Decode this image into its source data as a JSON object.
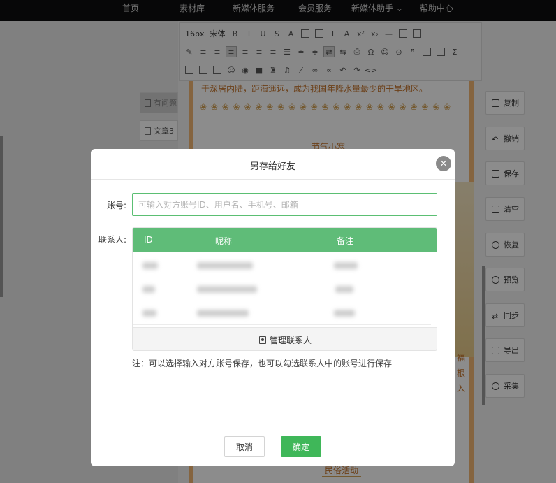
{
  "nav": {
    "items": [
      "首页",
      "素材库",
      "新媒体服务",
      "会员服务",
      "新媒体助手",
      "帮助中心"
    ],
    "dropdown_mark": "⌄"
  },
  "doc_tabs": [
    "有问题",
    "文章3"
  ],
  "toolbar": {
    "font_size": "16px",
    "font_family": "宋体"
  },
  "editor": {
    "paragraph": "于深居内陆，距海遥远，成为我国年降水量最少的干旱地区。",
    "leaves": "❀ ❀ ❀ ❀ ❀ ❀ ❀ ❀ ❀ ❀ ❀ ❀ ❀ ❀ ❀ ❀ ❀ ❀ ❀ ❀ ❀ ❀ ❀",
    "section_title": "节气小寒",
    "side_chars": [
      "福",
      "根",
      "入"
    ],
    "folk": "民俗活动"
  },
  "actions": [
    {
      "label": "复制",
      "icon": "copy-icon"
    },
    {
      "label": "撤销",
      "icon": "undo-icon"
    },
    {
      "label": "保存",
      "icon": "save-icon"
    },
    {
      "label": "清空",
      "icon": "trash-icon"
    },
    {
      "label": "恢复",
      "icon": "restore-icon"
    },
    {
      "label": "预览",
      "icon": "eye-icon"
    },
    {
      "label": "同步",
      "icon": "sync-icon"
    },
    {
      "label": "导出",
      "icon": "export-icon"
    },
    {
      "label": "采集",
      "icon": "collect-icon"
    }
  ],
  "modal": {
    "title": "另存给好友",
    "close": "×",
    "account_label": "账号:",
    "account_placeholder": "可输入对方账号ID、用户名、手机号、邮箱",
    "contacts_label": "联系人:",
    "table_headers": [
      "ID",
      "昵称",
      "备注"
    ],
    "manage_contacts": "管理联系人",
    "note": "注：可以选择输入对方账号保存，也可以勾选联系人中的账号进行保存",
    "cancel": "取消",
    "confirm": "确定"
  },
  "colors": {
    "accent_green": "#5fbc78",
    "confirm_green": "#3fb759",
    "arrow_red": "#e02020",
    "editor_orange": "#c5762e"
  }
}
